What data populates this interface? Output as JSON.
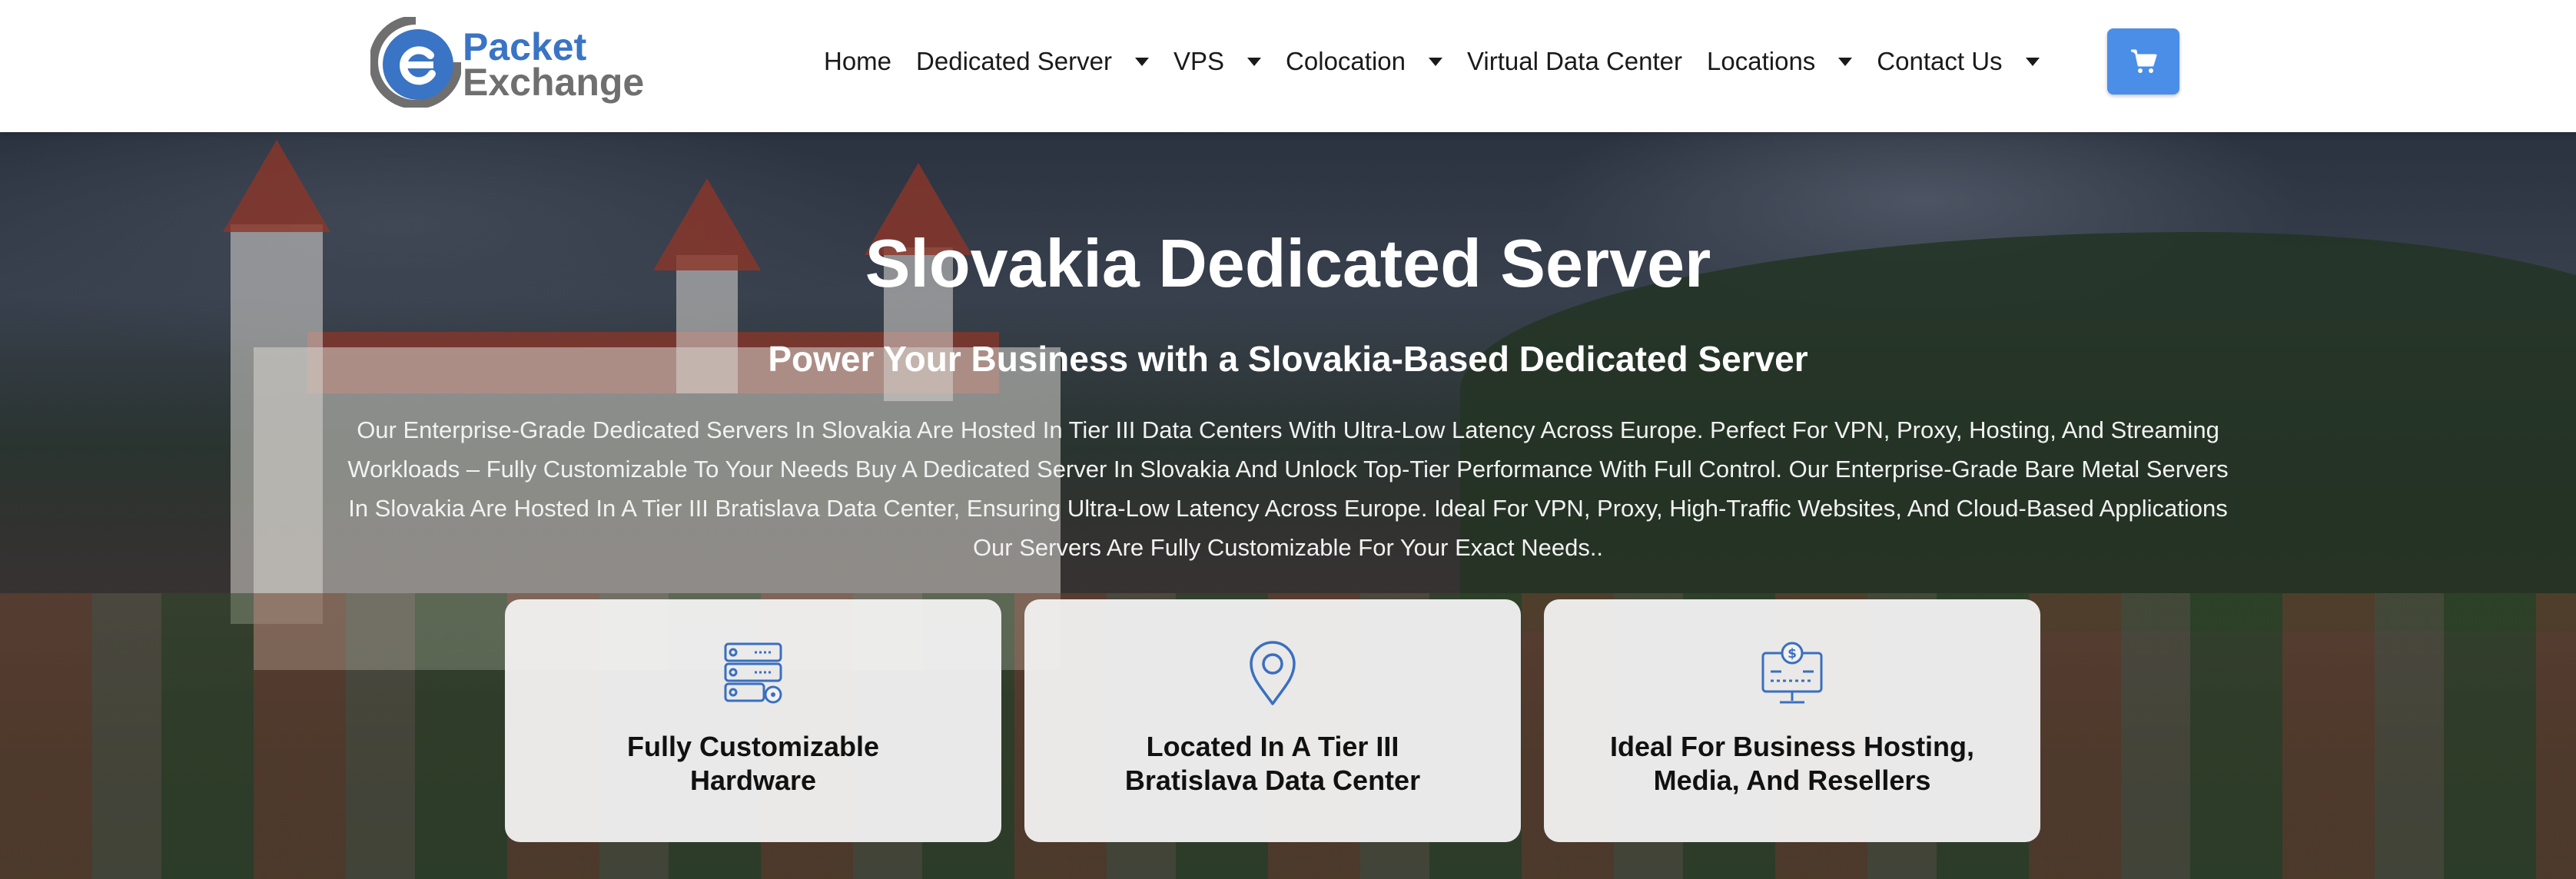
{
  "brand": {
    "logo_line1": "Packet",
    "logo_line2": "Exchange",
    "primary_color": "#3a74c4",
    "secondary_color": "#6f6f6f"
  },
  "nav": {
    "items": [
      {
        "label": "Home",
        "has_dropdown": false
      },
      {
        "label": "Dedicated Server",
        "has_dropdown": true
      },
      {
        "label": "VPS",
        "has_dropdown": true
      },
      {
        "label": "Colocation",
        "has_dropdown": true
      },
      {
        "label": "Virtual Data Center",
        "has_dropdown": false
      },
      {
        "label": "Locations",
        "has_dropdown": true
      },
      {
        "label": "Contact Us",
        "has_dropdown": true
      }
    ],
    "cart_icon": "shopping-cart-icon",
    "cart_color": "#4a8ee8"
  },
  "hero": {
    "title": "Slovakia Dedicated Server",
    "subtitle": "Power Your Business with a Slovakia-Based Dedicated Server",
    "description": "Our Enterprise-Grade Dedicated Servers In Slovakia Are Hosted In Tier III Data Centers With Ultra-Low Latency Across Europe. Perfect For VPN, Proxy, Hosting, And Streaming Workloads – Fully Customizable To Your Needs Buy A Dedicated Server In Slovakia And Unlock Top-Tier Performance With Full Control. Our Enterprise-Grade Bare Metal Servers In Slovakia Are Hosted In A Tier III Bratislava Data Center, Ensuring Ultra-Low Latency Across Europe. Ideal For VPN, Proxy, High-Traffic Websites, And Cloud-Based Applications Our Servers Are Fully Customizable For Your Exact Needs.."
  },
  "features": [
    {
      "icon": "server-gear-icon",
      "line1": "Fully Customizable",
      "line2": "Hardware"
    },
    {
      "icon": "location-pin-icon",
      "line1": "Located In A Tier III",
      "line2": "Bratislava Data Center"
    },
    {
      "icon": "monitor-dollar-icon",
      "line1": "Ideal For Business Hosting,",
      "line2": "Media, And Resellers"
    }
  ],
  "icon_color": "#3a6fc0"
}
